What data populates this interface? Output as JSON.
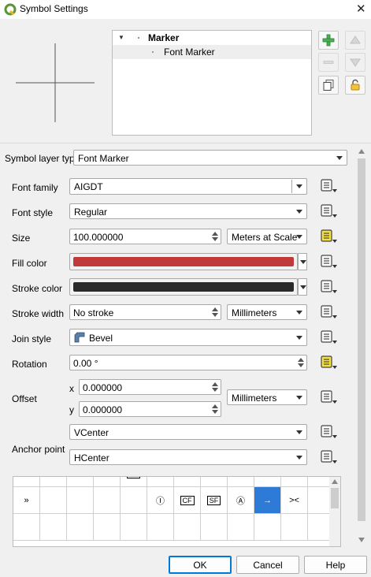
{
  "window": {
    "title": "Symbol Settings",
    "close_glyph": "✕"
  },
  "tree": {
    "items": [
      {
        "label": "Marker"
      },
      {
        "label": "Font Marker"
      }
    ]
  },
  "form": {
    "symbol_layer_type": {
      "label": "Symbol layer type",
      "value": "Font Marker"
    },
    "font_family": {
      "label": "Font family",
      "value": "AIGDT"
    },
    "font_style": {
      "label": "Font style",
      "value": "Regular"
    },
    "size": {
      "label": "Size",
      "value": "100.000000",
      "unit": "Meters at Scale"
    },
    "fill_color": {
      "label": "Fill color",
      "color": "#c0393b"
    },
    "stroke_color": {
      "label": "Stroke color",
      "color": "#2a2a2a"
    },
    "stroke_width": {
      "label": "Stroke width",
      "value": "No stroke",
      "unit": "Millimeters"
    },
    "join_style": {
      "label": "Join style",
      "value": "Bevel"
    },
    "rotation": {
      "label": "Rotation",
      "value": "0.00 °"
    },
    "offset": {
      "label": "Offset",
      "x_label": "x",
      "x_value": "0.000000",
      "y_label": "y",
      "y_value": "0.000000",
      "unit": "Millimeters"
    },
    "anchor_point": {
      "label": "Anchor point",
      "vertical": "VCenter",
      "horizontal": "HCenter"
    }
  },
  "grid": {
    "rows": [
      [
        "˙",
        "±",
        "",
        "",
        "ST",
        "",
        "",
        "",
        "",
        "",
        "",
        ""
      ],
      [
        "»",
        "",
        "",
        "",
        "",
        "Ⓘ",
        "CF",
        "SF",
        "Ⓐ",
        "→",
        "><",
        ""
      ],
      [
        "",
        "",
        "",
        "",
        "",
        "",
        "",
        "",
        "",
        "",
        "",
        ""
      ]
    ],
    "selected": {
      "row": 1,
      "col": 9
    }
  },
  "buttons": {
    "ok": "OK",
    "cancel": "Cancel",
    "help": "Help"
  },
  "colors": {
    "accent": "#0078d7",
    "selection": "#2e7bd7",
    "expression_active": "#f5e042"
  }
}
